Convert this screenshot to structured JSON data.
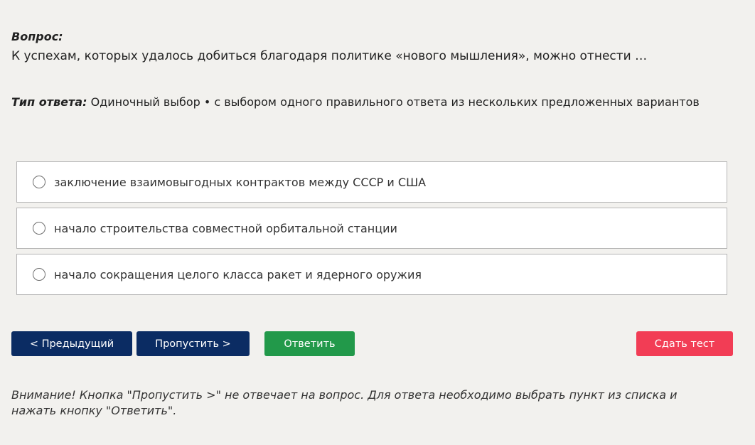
{
  "question": {
    "label": "Вопрос:",
    "text": "К успехам, которых удалось добиться благодаря политике «нового мышления», можно отнести …"
  },
  "answer_type": {
    "label": "Тип ответа:",
    "value": "Одиночный выбор • с выбором одного правильного ответа из нескольких предложенных вариантов"
  },
  "options": [
    {
      "label": "заключение взаимовыгодных контрактов между СССР и США",
      "selected": false
    },
    {
      "label": "начало строительства совместной орбитальной станции",
      "selected": false
    },
    {
      "label": "начало сокращения целого класса ракет и ядерного оружия",
      "selected": false
    }
  ],
  "buttons": {
    "prev": "< Предыдущий",
    "skip": "Пропустить >",
    "answer": "Ответить",
    "submit": "Сдать тест"
  },
  "warning": "Внимание! Кнопка \"Пропустить >\" не отвечает на вопрос. Для ответа необходимо выбрать пункт из списка и нажать кнопку \"Ответить\".",
  "colors": {
    "background": "#f2f1ee",
    "nav_button": "#0b2c63",
    "answer_button": "#22994a",
    "submit_button": "#f23d55"
  }
}
